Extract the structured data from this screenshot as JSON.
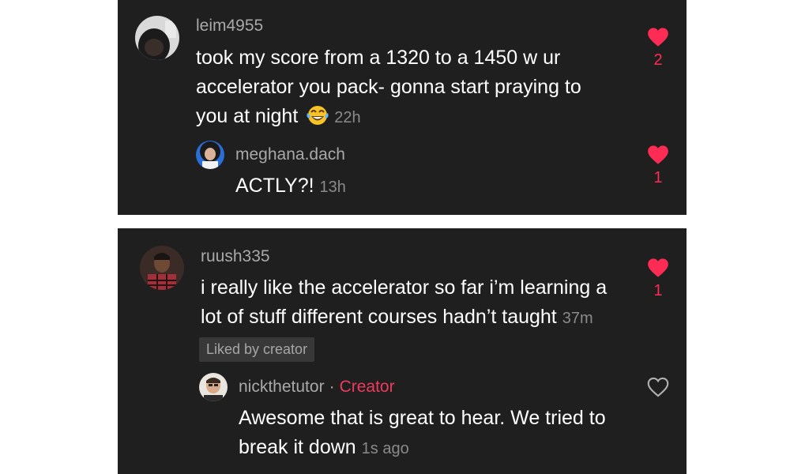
{
  "colors": {
    "panel_bg": "#1f1f1f",
    "like_red": "#fe2c55",
    "creator_red": "#ee3a5c",
    "username_gray": "#a9a9a9",
    "time_gray": "#8a8a8a"
  },
  "comments": [
    {
      "username": "leim4955",
      "text_lines": [
        "took my score from a 1320 to a 1450 w ur",
        "accelerator you pack- gonna start praying to",
        "you at night"
      ],
      "emoji": "laughing-tears-emoji",
      "time": "22h",
      "likes": "2",
      "liked": true,
      "reply": {
        "username": "meghana.dach",
        "text": "ACTLY?!",
        "time": "13h",
        "likes": "1",
        "liked": true
      }
    },
    {
      "username": "ruush335",
      "text_lines": [
        "i really like the accelerator so far i’m learning a",
        "lot of stuff different courses hadn’t taught"
      ],
      "time": "37m",
      "likes": "1",
      "liked": true,
      "liked_by_creator": "Liked by creator",
      "reply": {
        "username": "nickthetutor",
        "separator": "·",
        "badge": "Creator",
        "text_lines": [
          "Awesome that is great to hear. We tried to",
          "break it down"
        ],
        "time": "1s ago",
        "liked": false,
        "like_icon": "heart-outline-icon"
      }
    }
  ]
}
